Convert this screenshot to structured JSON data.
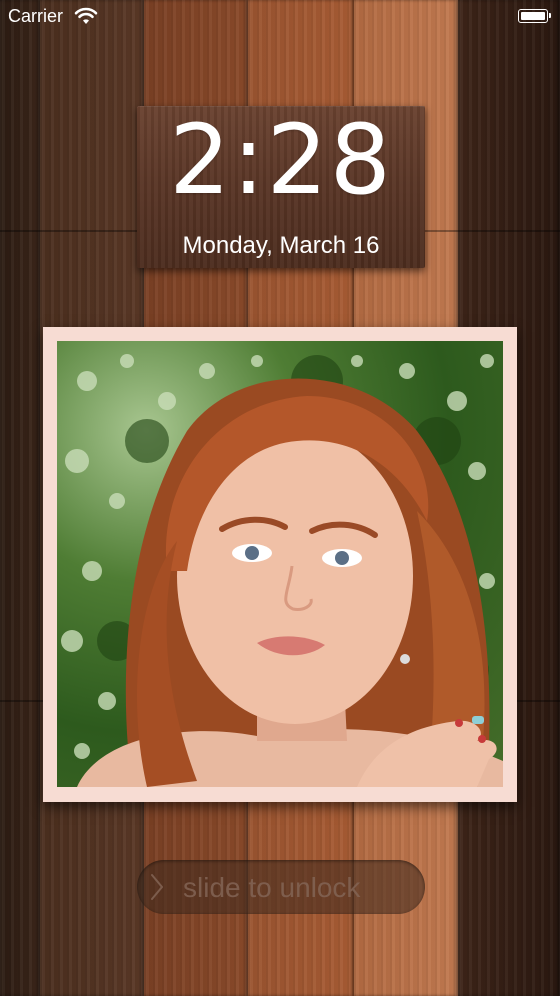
{
  "status_bar": {
    "carrier": "Carrier",
    "icons": {
      "wifi": "wifi-icon",
      "battery": "battery-icon"
    }
  },
  "lock_screen": {
    "time": "2:28",
    "date": "Monday, March 16",
    "unlock_label": "slide to unlock",
    "unlock_icon": "chevron-right-icon"
  },
  "photo": {
    "subject": "portrait-photo"
  },
  "colors": {
    "frame": "#f7dcd3",
    "text": "#ffffff"
  }
}
